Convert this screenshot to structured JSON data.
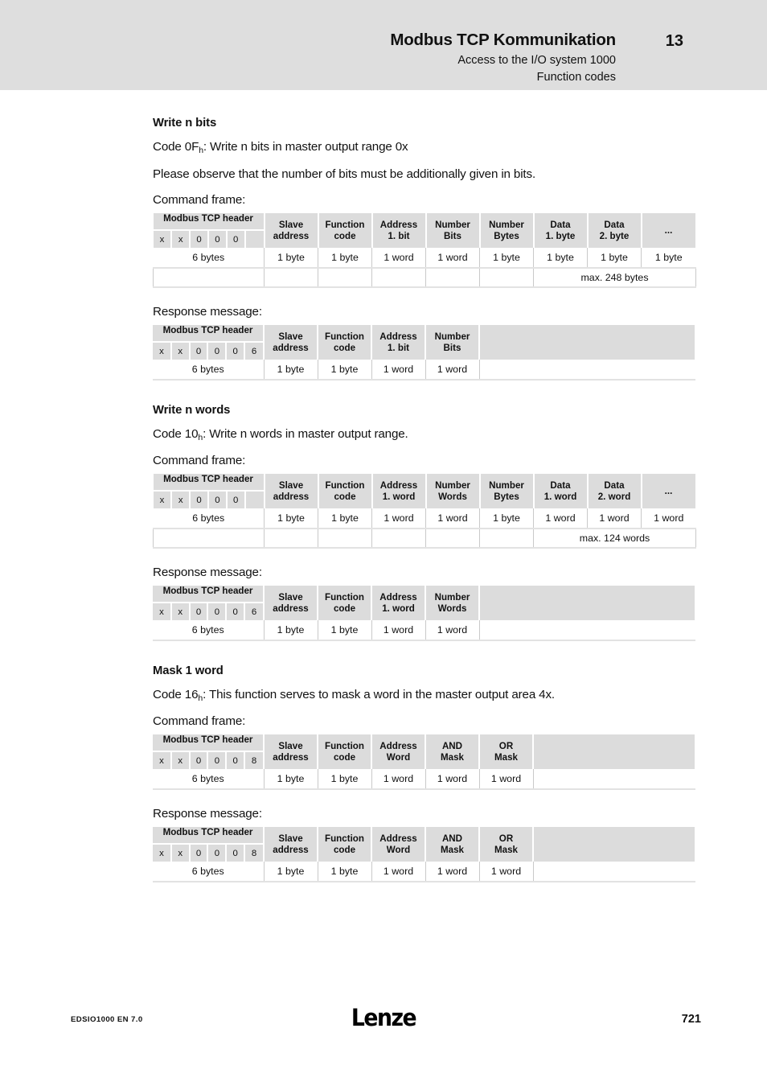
{
  "header": {
    "title": "Modbus TCP Kommunikation",
    "subtitle1": "Access to the I/O system 1000",
    "subtitle2": "Function codes",
    "chapter": "13"
  },
  "sections": [
    {
      "heading": "Write n bits",
      "code_prefix": "Code 0F",
      "code_sub": "h",
      "code_rest": ": Write n bits in master output range 0x",
      "note": "Please observe that the number of bits must be additionally given in bits.",
      "command_caption": "Command frame:",
      "response_caption": "Response message:"
    },
    {
      "heading": "Write n words",
      "code_prefix": "Code 10",
      "code_sub": "h",
      "code_rest": ": Write n words in master output range.",
      "command_caption": "Command frame:",
      "response_caption": "Response message:"
    },
    {
      "heading": "Mask 1 word",
      "code_prefix": "Code 16",
      "code_sub": "h",
      "code_rest": ": This function serves to mask a word in the master output area 4x.",
      "command_caption": "Command frame:",
      "response_caption": "Response message:"
    }
  ],
  "tables": {
    "t1": {
      "modbus_label": "Modbus TCP header",
      "modbus_bytes": [
        "x",
        "x",
        "0",
        "0",
        "0",
        ""
      ],
      "columns": [
        "Slave\naddress",
        "Function\ncode",
        "Address\n1. bit",
        "Number\nBits",
        "Number\nBytes",
        "Data\n1. byte",
        "Data\n2. byte",
        "..."
      ],
      "col_line1": [
        "Slave",
        "Function",
        "Address",
        "Number",
        "Number",
        "Data",
        "Data",
        "..."
      ],
      "col_line2": [
        "address",
        "code",
        "1. bit",
        "Bits",
        "Bytes",
        "1. byte",
        "2. byte",
        ""
      ],
      "sizes_header": "6 bytes",
      "sizes": [
        "1 byte",
        "1 byte",
        "1 word",
        "1 word",
        "1 byte",
        "1 byte",
        "1 byte",
        "1 byte"
      ],
      "max_note": "max. 248 bytes",
      "max_span": 3
    },
    "t2": {
      "modbus_label": "Modbus TCP header",
      "modbus_bytes": [
        "x",
        "x",
        "0",
        "0",
        "0",
        "6"
      ],
      "col_line1": [
        "Slave",
        "Function",
        "Address",
        "Number"
      ],
      "col_line2": [
        "address",
        "code",
        "1. bit",
        "Bits"
      ],
      "sizes_header": "6 bytes",
      "sizes": [
        "1 byte",
        "1 byte",
        "1 word",
        "1 word"
      ]
    },
    "t3": {
      "modbus_label": "Modbus TCP header",
      "modbus_bytes": [
        "x",
        "x",
        "0",
        "0",
        "0",
        ""
      ],
      "col_line1": [
        "Slave",
        "Function",
        "Address",
        "Number",
        "Number",
        "Data",
        "Data",
        "..."
      ],
      "col_line2": [
        "address",
        "code",
        "1. word",
        "Words",
        "Bytes",
        "1. word",
        "2. word",
        ""
      ],
      "sizes_header": "6 bytes",
      "sizes": [
        "1 byte",
        "1 byte",
        "1 word",
        "1 word",
        "1 byte",
        "1 word",
        "1 word",
        "1 word"
      ],
      "max_note": "max. 124 words",
      "max_span": 3
    },
    "t4": {
      "modbus_label": "Modbus TCP header",
      "modbus_bytes": [
        "x",
        "x",
        "0",
        "0",
        "0",
        "6"
      ],
      "col_line1": [
        "Slave",
        "Function",
        "Address",
        "Number"
      ],
      "col_line2": [
        "address",
        "code",
        "1. word",
        "Words"
      ],
      "sizes_header": "6 bytes",
      "sizes": [
        "1 byte",
        "1 byte",
        "1 word",
        "1 word"
      ]
    },
    "t5": {
      "modbus_label": "Modbus TCP header",
      "modbus_bytes": [
        "x",
        "x",
        "0",
        "0",
        "0",
        "8"
      ],
      "col_line1": [
        "Slave",
        "Function",
        "Address",
        "AND",
        "OR"
      ],
      "col_line2": [
        "address",
        "code",
        "Word",
        "Mask",
        "Mask"
      ],
      "sizes_header": "6 bytes",
      "sizes": [
        "1 byte",
        "1 byte",
        "1 word",
        "1 word",
        "1 word"
      ]
    },
    "t6": {
      "modbus_label": "Modbus TCP header",
      "modbus_bytes": [
        "x",
        "x",
        "0",
        "0",
        "0",
        "8"
      ],
      "col_line1": [
        "Slave",
        "Function",
        "Address",
        "AND",
        "OR"
      ],
      "col_line2": [
        "address",
        "code",
        "Word",
        "Mask",
        "Mask"
      ],
      "sizes_header": "6 bytes",
      "sizes": [
        "1 byte",
        "1 byte",
        "1 word",
        "1 word",
        "1 word"
      ]
    }
  },
  "footer": {
    "doc_id": "EDSIO1000  EN  7.0",
    "logo": "Lenze",
    "page_number": "721"
  },
  "colors": {
    "header_band": "#dedede",
    "cell_gray": "#dcdcdc",
    "rule": "#e2e2e2"
  }
}
